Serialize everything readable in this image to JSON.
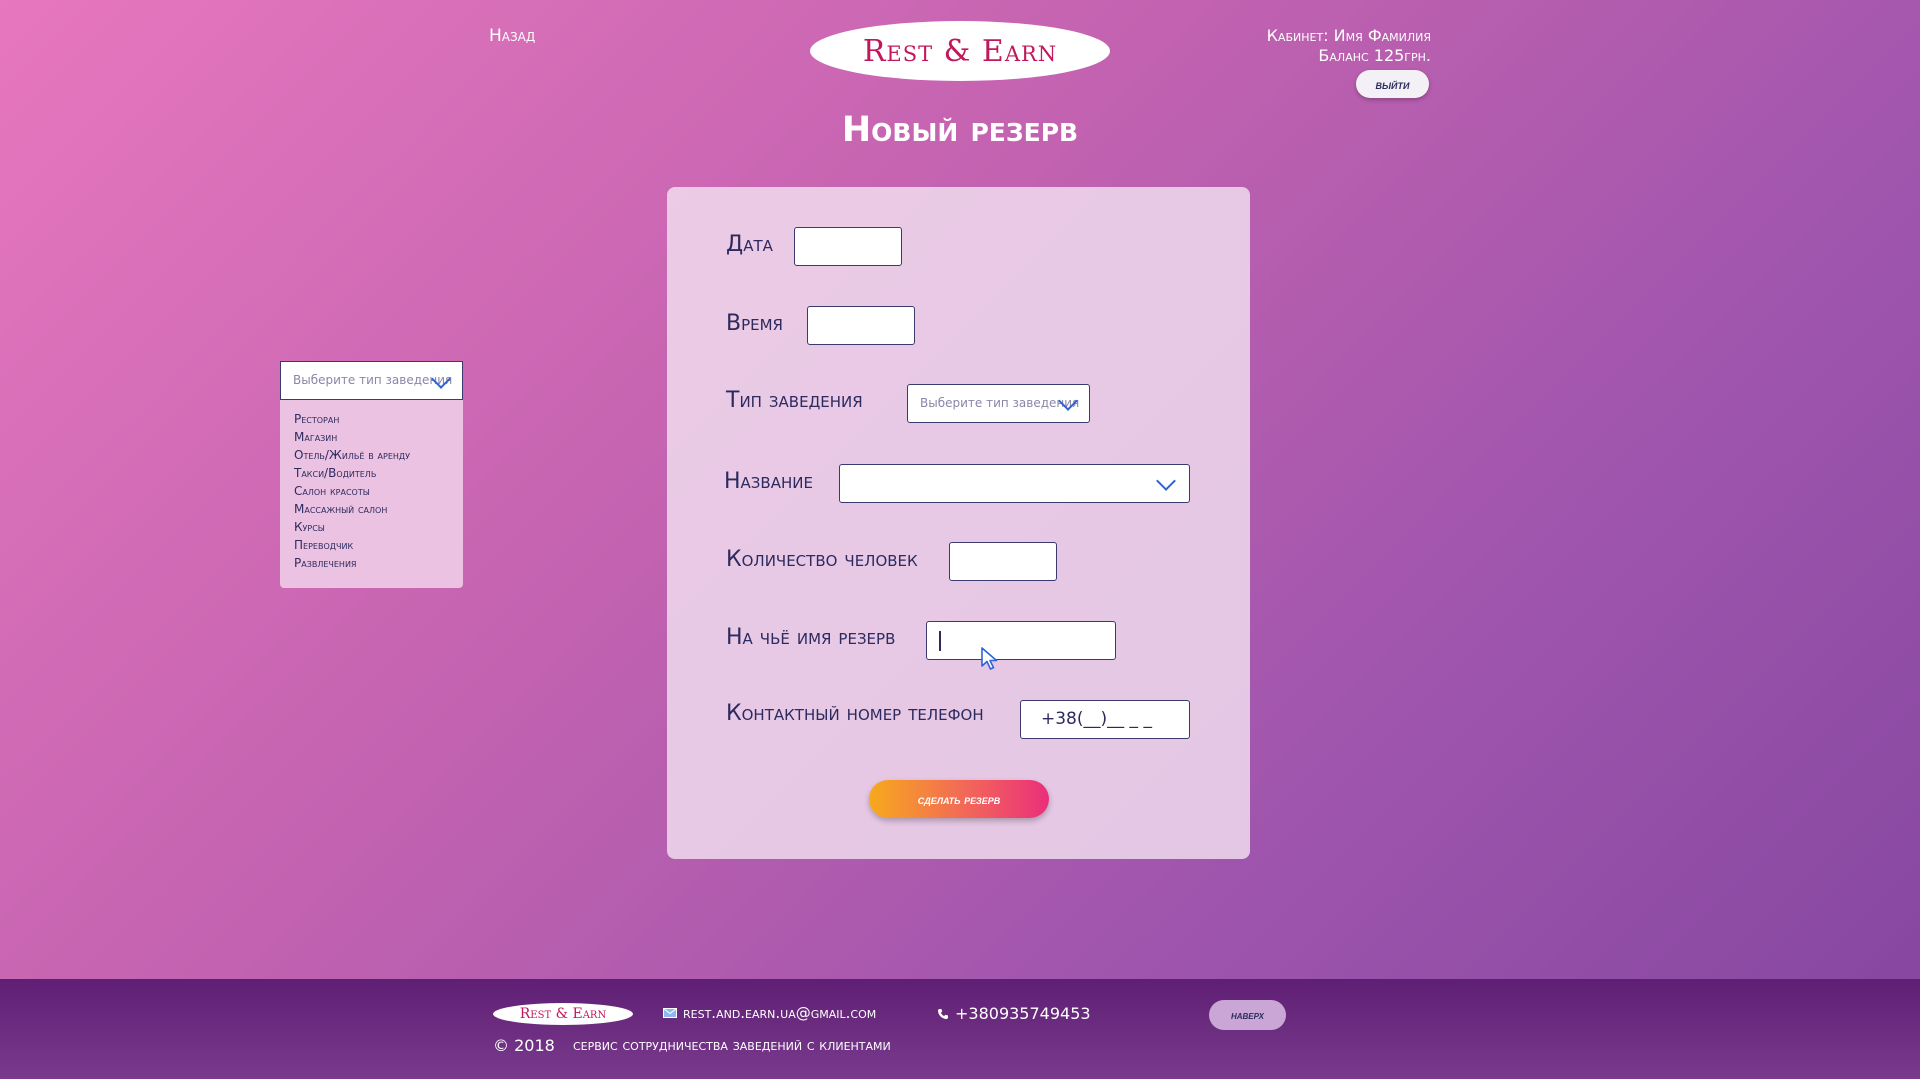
{
  "header": {
    "back_label": "Назад",
    "logo_text": "Rest & Earn",
    "account_line": "Кабинет: Имя Фамилия",
    "balance_line": "Баланс 125грн.",
    "logout_label": "выйти"
  },
  "page_title": "Новый резерв",
  "left_dropdown": {
    "placeholder": "Выберите тип заведения",
    "options": [
      "Ресторан",
      "Магазин",
      "Отель/Жильё в аренду",
      "Такси/Водитель",
      "Салон красоты",
      "Массажный салон",
      "Курсы",
      "Переводчик",
      "Развлечения"
    ]
  },
  "form": {
    "date_label": "Дата",
    "date_value": "",
    "time_label": "Время",
    "time_value": "",
    "type_label": "Тип заведения",
    "type_placeholder": "Выберите тип заведения",
    "name_label": "Название",
    "name_value": "",
    "people_label": "Количество человек",
    "people_value": "",
    "reserve_name_label": "На чьё имя резерв",
    "reserve_name_value": "",
    "phone_label": "Контактный номер телефон",
    "phone_value": "+38(__)__ _ _",
    "submit_label": "сделать резерв"
  },
  "footer": {
    "logo_text": "Rest & Earn",
    "email": "rest.and.earn.ua@gmail.com",
    "phone": "+380935749453",
    "copyright": "© 2018",
    "tagline": "сервис сотрудничества заведений с клиентами",
    "top_label": "наверх"
  },
  "icons": {
    "mail": "mail-icon",
    "phone": "phone-icon",
    "chevron": "chevron-down-icon",
    "cursor": "mouse-cursor-icon"
  },
  "colors": {
    "accent_blue": "#2f64d4",
    "logo_red": "#c2185b",
    "button_gradient_start": "#f7a91c",
    "button_gradient_end": "#ea2f7a"
  }
}
